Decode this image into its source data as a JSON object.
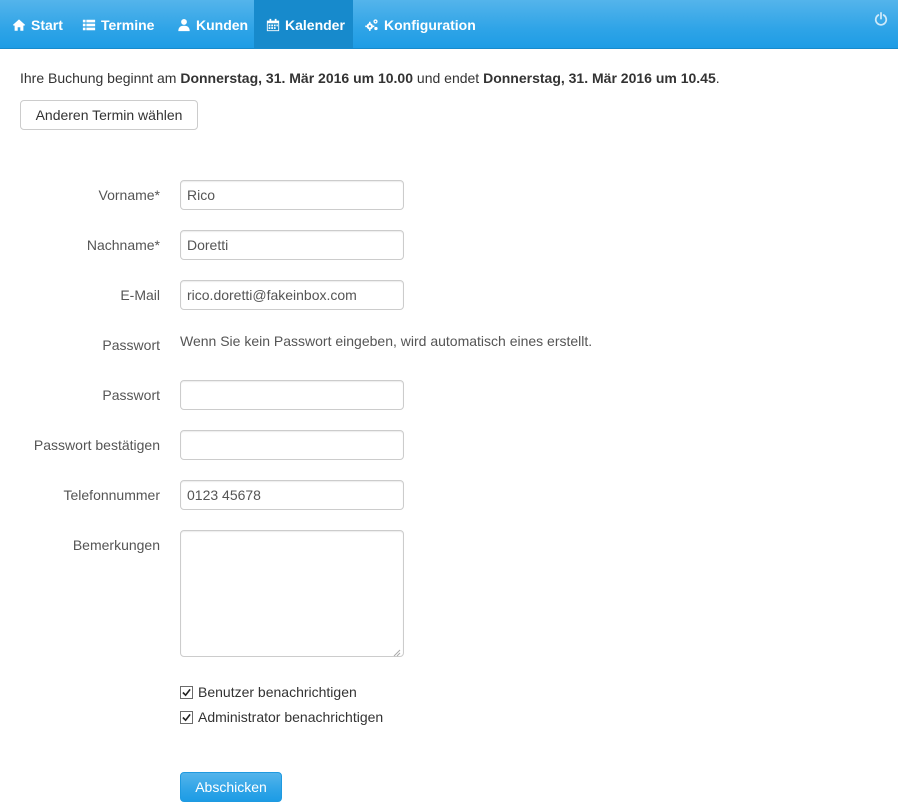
{
  "nav": {
    "items": [
      {
        "label": "Start",
        "icon": "home-icon"
      },
      {
        "label": "Termine",
        "icon": "list-icon"
      },
      {
        "label": "Kunden",
        "icon": "user-icon"
      },
      {
        "label": "Kalender",
        "icon": "calendar-icon",
        "active": true
      },
      {
        "label": "Konfiguration",
        "icon": "cogs-icon"
      }
    ],
    "power_icon": "power-icon"
  },
  "booking": {
    "prefix": "Ihre Buchung beginnt am ",
    "start": "Donnerstag, 31. Mär 2016 um 10.00",
    "middle": " und endet ",
    "end": "Donnerstag, 31. Mär 2016 um 10.45",
    "suffix": "."
  },
  "change_button": "Anderen Termin wählen",
  "form": {
    "firstname_label": "Vorname*",
    "firstname_value": "Rico",
    "lastname_label": "Nachname*",
    "lastname_value": "Doretti",
    "email_label": "E-Mail",
    "email_value": "rico.doretti@fakeinbox.com",
    "password_info_label": "Passwort",
    "password_info_text": "Wenn Sie kein Passwort eingeben, wird automatisch eines erstellt.",
    "password_label": "Passwort",
    "password_value": "",
    "password_confirm_label": "Passwort bestätigen",
    "password_confirm_value": "",
    "phone_label": "Telefonnummer",
    "phone_value": "0123 45678",
    "remarks_label": "Bemerkungen",
    "remarks_value": "",
    "notify_user_label": "Benutzer benachrichtigen",
    "notify_user_checked": true,
    "notify_admin_label": "Administrator benachrichtigen",
    "notify_admin_checked": true,
    "submit_label": "Abschicken"
  },
  "colors": {
    "navbar": "#2fa4e7",
    "navbar_active": "#178acc",
    "primary": "#2fa4e7"
  }
}
